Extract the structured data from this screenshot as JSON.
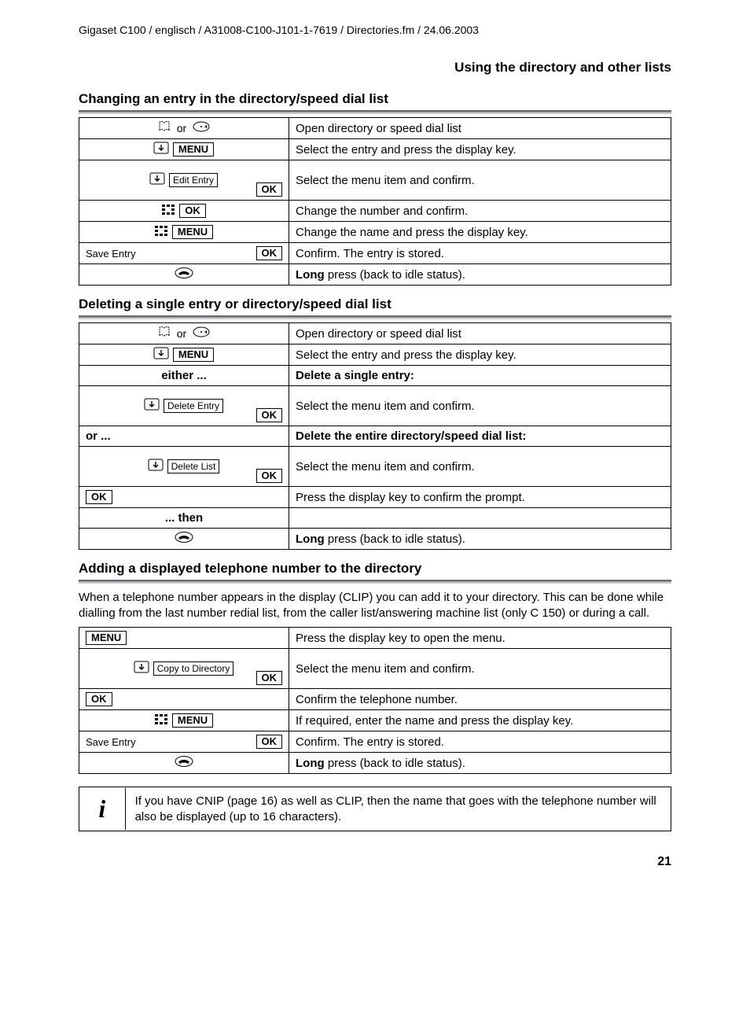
{
  "header": {
    "path": "Gigaset C100 / englisch / A31008-C100-J101-1-7619 / Directories.fm / 24.06.2003",
    "breadcrumb": "Using the directory and other lists"
  },
  "labels": {
    "or": "or",
    "menu": "MENU",
    "ok": "OK",
    "edit_entry": "Edit Entry",
    "save_entry": "Save Entry",
    "delete_entry": "Delete Entry",
    "delete_list": "Delete List",
    "copy_to_directory": "Copy to Directory",
    "either": "either ...",
    "or_row": "or ...",
    "then_row": "... then"
  },
  "sections": {
    "s1": {
      "title": "Changing an entry in the directory/speed dial list",
      "rows": {
        "r1": "Open directory or speed dial list",
        "r2": "Select the entry and press the display key.",
        "r3": "Select the menu item and confirm.",
        "r4": "Change the number and confirm.",
        "r5": "Change the name and press the display key.",
        "r6": "Confirm. The entry is stored.",
        "r7_bold": "Long",
        "r7_rest": " press (back to idle status)."
      }
    },
    "s2": {
      "title": "Deleting a single entry or directory/speed dial list",
      "rows": {
        "r1": "Open directory or speed dial list",
        "r2": "Select the entry and press the display key.",
        "r3": "Delete a single entry:",
        "r4": "Select the menu item and confirm.",
        "r5": "Delete the entire directory/speed dial list:",
        "r6": "Select the menu item and confirm.",
        "r7": "Press the display key to confirm the prompt.",
        "r8_bold": "Long",
        "r8_rest": " press (back to idle status)."
      }
    },
    "s3": {
      "title": "Adding a displayed telephone number to the directory",
      "intro": "When a telephone number appears in the display (CLIP) you can add it to your directory. This can be done while dialling from the last number redial list, from the caller list/answering machine list (only C 150) or during a call.",
      "rows": {
        "r1": "Press the display key to open the menu.",
        "r2": "Select the menu item and confirm.",
        "r3": "Confirm the telephone number.",
        "r4": "If required, enter the name and press the display key.",
        "r5": "Confirm. The entry is stored.",
        "r6_bold": "Long",
        "r6_rest": " press (back to idle status)."
      }
    }
  },
  "info": {
    "text": "If you have CNIP (page 16) as well as CLIP, then the name that goes with the telephone number will also be displayed (up to 16 characters)."
  },
  "page_number": "21"
}
